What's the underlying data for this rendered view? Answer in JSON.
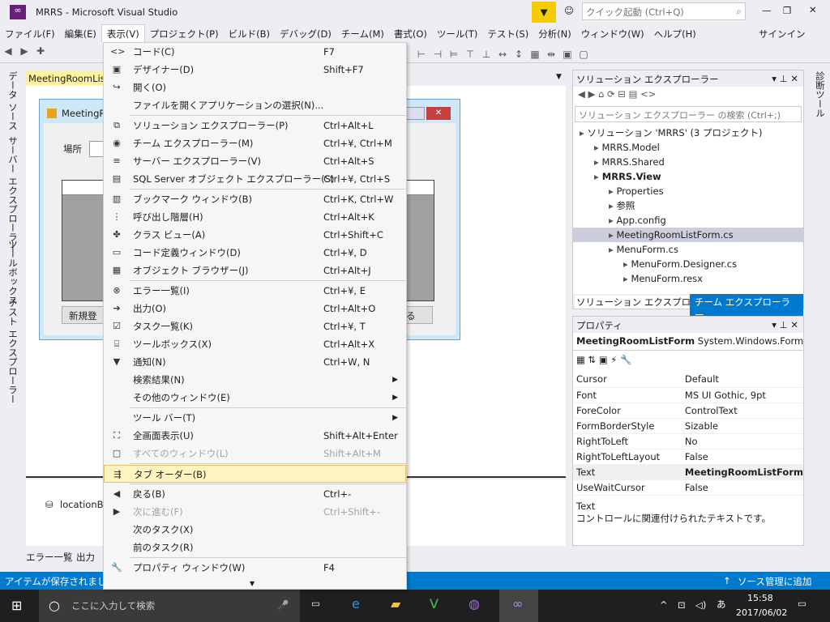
{
  "title": "MRRS - Microsoft Visual Studio",
  "quick_launch": "クイック起動 (Ctrl+Q)",
  "signin": "サインイン",
  "menubar": [
    "ファイル(F)",
    "編集(E)",
    "表示(V)",
    "プロジェクト(P)",
    "ビルド(B)",
    "デバッグ(D)",
    "チーム(M)",
    "書式(O)",
    "ツール(T)",
    "テスト(S)",
    "分析(N)",
    "ウィンドウ(W)",
    "ヘルプ(H)"
  ],
  "left_tabs": [
    "データ ソース",
    "サーバー エクスプローラー",
    "ツールボックス",
    "テスト エクスプローラー"
  ],
  "right_tab": "診断ツール",
  "doc_tab": "MeetingRoomList",
  "form": {
    "title": "MeetingR",
    "location_label": "場所",
    "new_button": "新規登",
    "close_fragment": "る"
  },
  "tray_item": "locationBi",
  "bottom_tabs": [
    "エラー一覧",
    "出力"
  ],
  "menu": [
    {
      "icon": "code-icon",
      "g": "<>",
      "label": "コード(C)",
      "sc": "F7"
    },
    {
      "icon": "designer-icon",
      "g": "▣",
      "label": "デザイナー(D)",
      "sc": "Shift+F7"
    },
    {
      "icon": "open-icon",
      "g": "↪",
      "label": "開く(O)",
      "sc": ""
    },
    {
      "icon": "",
      "g": "",
      "label": "ファイルを開くアプリケーションの選択(N)...",
      "sc": ""
    },
    {
      "sep": true
    },
    {
      "icon": "solution-explorer-icon",
      "g": "⧉",
      "label": "ソリューション エクスプローラー(P)",
      "sc": "Ctrl+Alt+L"
    },
    {
      "icon": "team-explorer-icon",
      "g": "◉",
      "label": "チーム エクスプローラー(M)",
      "sc": "Ctrl+¥, Ctrl+M"
    },
    {
      "icon": "server-explorer-icon",
      "g": "≡",
      "label": "サーバー エクスプローラー(V)",
      "sc": "Ctrl+Alt+S"
    },
    {
      "icon": "sql-server-icon",
      "g": "▤",
      "label": "SQL Server オブジェクト エクスプローラー(S)",
      "sc": "Ctrl+¥, Ctrl+S"
    },
    {
      "sep": true
    },
    {
      "icon": "bookmark-icon",
      "g": "▥",
      "label": "ブックマーク ウィンドウ(B)",
      "sc": "Ctrl+K, Ctrl+W"
    },
    {
      "icon": "call-hierarchy-icon",
      "g": "⋮",
      "label": "呼び出し階層(H)",
      "sc": "Ctrl+Alt+K"
    },
    {
      "icon": "class-view-icon",
      "g": "✤",
      "label": "クラス ビュー(A)",
      "sc": "Ctrl+Shift+C"
    },
    {
      "icon": "code-definition-icon",
      "g": "▭",
      "label": "コード定義ウィンドウ(D)",
      "sc": "Ctrl+¥, D"
    },
    {
      "icon": "object-browser-icon",
      "g": "▦",
      "label": "オブジェクト ブラウザー(J)",
      "sc": "Ctrl+Alt+J"
    },
    {
      "sep": true
    },
    {
      "icon": "error-list-icon",
      "g": "⊗",
      "label": "エラー一覧(I)",
      "sc": "Ctrl+¥, E"
    },
    {
      "icon": "output-icon",
      "g": "➔",
      "label": "出力(O)",
      "sc": "Ctrl+Alt+O"
    },
    {
      "icon": "task-list-icon",
      "g": "☑",
      "label": "タスク一覧(K)",
      "sc": "Ctrl+¥, T"
    },
    {
      "icon": "toolbox-icon",
      "g": "⌸",
      "label": "ツールボックス(X)",
      "sc": "Ctrl+Alt+X"
    },
    {
      "icon": "notification-icon",
      "g": "▼",
      "label": "通知(N)",
      "sc": "Ctrl+W, N"
    },
    {
      "icon": "",
      "g": "",
      "label": "検索結果(N)",
      "sc": "",
      "arrow": true
    },
    {
      "icon": "",
      "g": "",
      "label": "その他のウィンドウ(E)",
      "sc": "",
      "arrow": true
    },
    {
      "sep": true
    },
    {
      "icon": "",
      "g": "",
      "label": "ツール バー(T)",
      "sc": "",
      "arrow": true
    },
    {
      "icon": "full-screen-icon",
      "g": "⛶",
      "label": "全画面表示(U)",
      "sc": "Shift+Alt+Enter"
    },
    {
      "icon": "all-windows-icon",
      "g": "▢",
      "label": "すべてのウィンドウ(L)",
      "sc": "Shift+Alt+M",
      "dis": true
    },
    {
      "sep": true
    },
    {
      "icon": "tab-order-icon",
      "g": "⇶",
      "label": "タブ オーダー(B)",
      "sc": "",
      "hl": true
    },
    {
      "sep": true
    },
    {
      "icon": "back-icon",
      "g": "◀",
      "label": "戻る(B)",
      "sc": "Ctrl+-"
    },
    {
      "icon": "forward-icon",
      "g": "▶",
      "label": "次に進む(F)",
      "sc": "Ctrl+Shift+-",
      "dis": true
    },
    {
      "icon": "",
      "g": "",
      "label": "次のタスク(X)",
      "sc": ""
    },
    {
      "icon": "",
      "g": "",
      "label": "前のタスク(R)",
      "sc": ""
    },
    {
      "sep": true
    },
    {
      "icon": "wrench-icon",
      "g": "🔧",
      "label": "プロパティ ウィンドウ(W)",
      "sc": "F4"
    }
  ],
  "solution": {
    "title": "ソリューション エクスプローラー",
    "search": "ソリューション エクスプローラー の検索 (Ctrl+;)",
    "tree": [
      {
        "indent": 0,
        "label": "ソリューション 'MRRS' (3 プロジェクト)"
      },
      {
        "indent": 1,
        "label": "MRRS.Model"
      },
      {
        "indent": 1,
        "label": "MRRS.Shared"
      },
      {
        "indent": 1,
        "label": "MRRS.View",
        "bold": true
      },
      {
        "indent": 2,
        "label": "Properties"
      },
      {
        "indent": 2,
        "label": "参照"
      },
      {
        "indent": 2,
        "label": "App.config"
      },
      {
        "indent": 2,
        "label": "MeetingRoomListForm.cs",
        "sel": true
      },
      {
        "indent": 2,
        "label": "MenuForm.cs"
      },
      {
        "indent": 3,
        "label": "MenuForm.Designer.cs"
      },
      {
        "indent": 3,
        "label": "MenuForm.resx"
      }
    ],
    "tabs": [
      "ソリューション エクスプローラー",
      "チーム エクスプローラー"
    ]
  },
  "properties": {
    "title": "プロパティ",
    "object": "MeetingRoomListForm",
    "type": "System.Windows.Forms.Fo",
    "rows": [
      [
        "Cursor",
        "Default"
      ],
      [
        "Font",
        "MS UI Gothic, 9pt"
      ],
      [
        "ForeColor",
        "ControlText"
      ],
      [
        "FormBorderStyle",
        "Sizable"
      ],
      [
        "RightToLeft",
        "No"
      ],
      [
        "RightToLeftLayout",
        "False"
      ],
      [
        "Text",
        "MeetingRoomListForm"
      ],
      [
        "UseWaitCursor",
        "False"
      ]
    ],
    "desc_title": "Text",
    "desc": "コントロールに関連付けられたテキストです。"
  },
  "status": "アイテムが保存されました",
  "source_control": "ソース管理に追加",
  "taskbar": {
    "search": "ここに入力して検索",
    "time": "15:58",
    "date": "2017/06/02",
    "ime": "あ"
  }
}
